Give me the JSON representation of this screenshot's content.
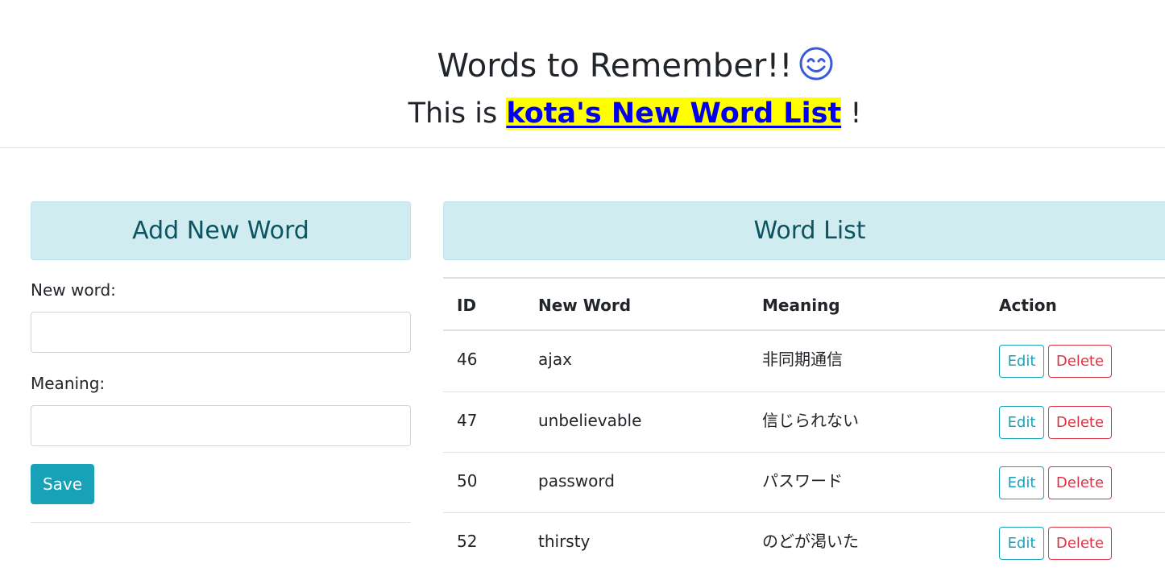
{
  "header": {
    "title": "Words to Remember!!",
    "subtitle_prefix": "This is",
    "list_name": "kota's New Word List",
    "subtitle_suffix": "!",
    "smiley_icon": "smiling-face-icon"
  },
  "add_form": {
    "heading": "Add New Word",
    "new_word_label": "New word:",
    "new_word_value": "",
    "meaning_label": "Meaning:",
    "meaning_value": "",
    "save_label": "Save"
  },
  "word_list": {
    "heading": "Word List",
    "columns": [
      "ID",
      "New Word",
      "Meaning",
      "Action"
    ],
    "rows": [
      {
        "id": "46",
        "word": "ajax",
        "meaning": "非同期通信",
        "edit_label": "Edit",
        "delete_label": "Delete"
      },
      {
        "id": "47",
        "word": "unbelievable",
        "meaning": "信じられない",
        "edit_label": "Edit",
        "delete_label": "Delete"
      },
      {
        "id": "50",
        "word": "password",
        "meaning": "パスワード",
        "edit_label": "Edit",
        "delete_label": "Delete"
      },
      {
        "id": "52",
        "word": "thirsty",
        "meaning": "のどが渇いた",
        "edit_label": "Edit",
        "delete_label": "Delete"
      }
    ]
  },
  "colors": {
    "accent": "#17a2b8",
    "danger": "#dc3545",
    "card_header_bg": "#d1ecf1",
    "card_header_text": "#0c5460",
    "highlight_bg": "#ffff00",
    "highlight_text": "#0000ee"
  }
}
